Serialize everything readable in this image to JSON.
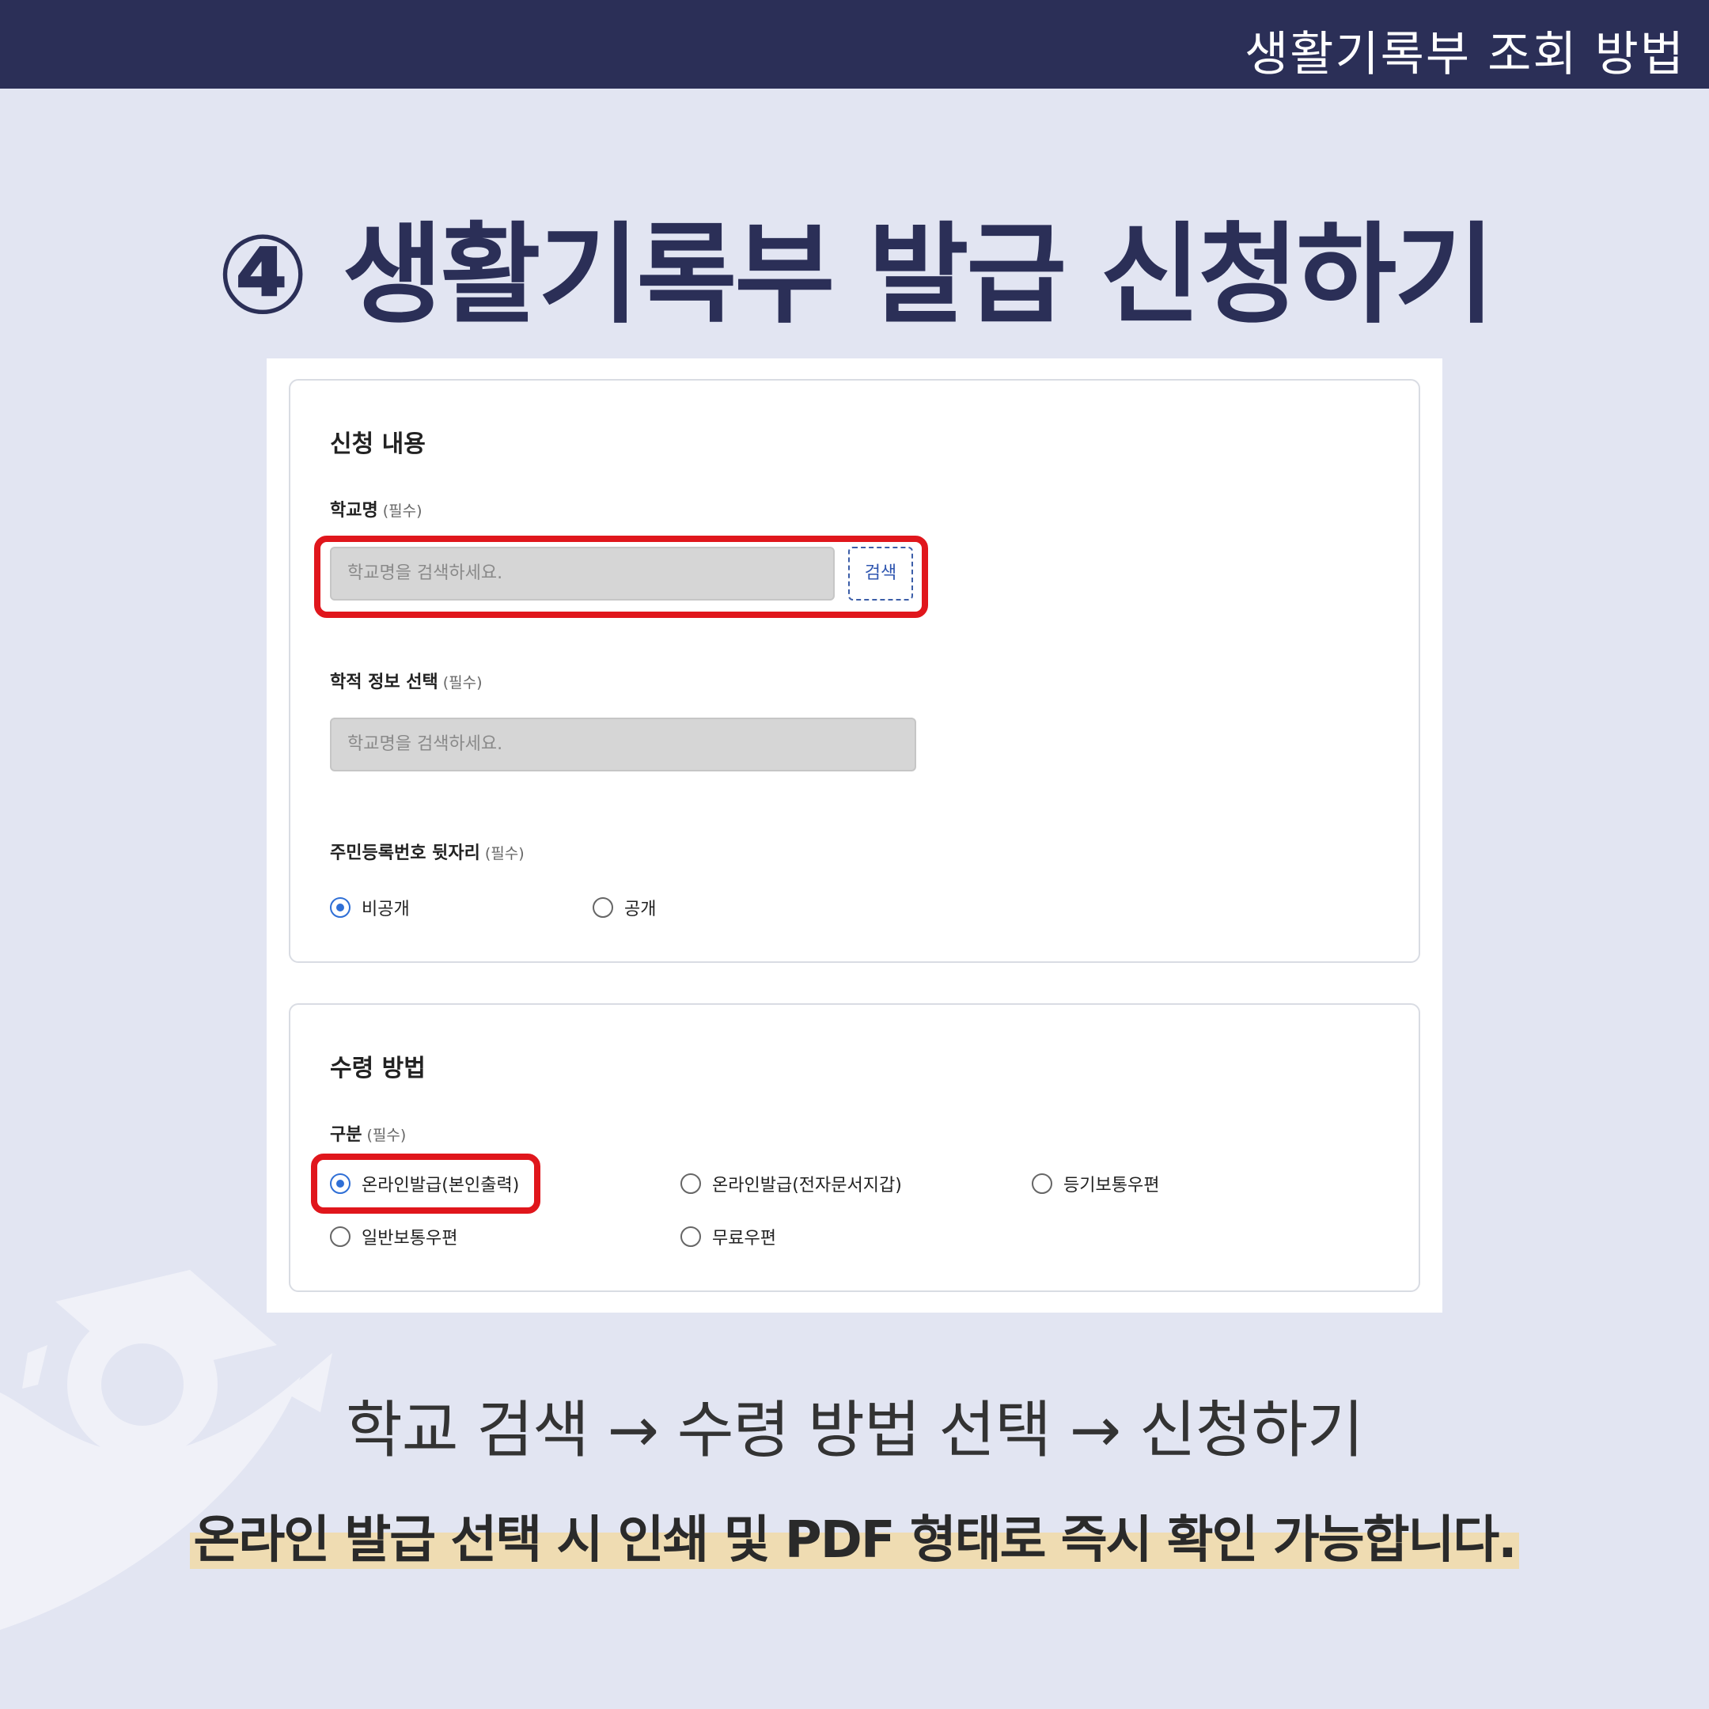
{
  "header": {
    "title": "생활기록부 조회 방법"
  },
  "headline": "④ 생활기록부 발급 신청하기",
  "form": {
    "section1_title": "신청 내용",
    "school": {
      "label": "학교명",
      "required": "(필수)",
      "placeholder": "학교명을 검색하세요.",
      "search_button": "검색"
    },
    "academic": {
      "label": "학적 정보 선택",
      "required": "(필수)",
      "placeholder": "학교명을 검색하세요."
    },
    "resident": {
      "label": "주민등록번호 뒷자리",
      "required": "(필수)",
      "options": [
        {
          "label": "비공개",
          "selected": true
        },
        {
          "label": "공개",
          "selected": false
        }
      ]
    },
    "section2_title": "수령 방법",
    "method": {
      "label": "구분",
      "required": "(필수)",
      "options": [
        {
          "label": "온라인발급(본인출력)",
          "selected": true
        },
        {
          "label": "온라인발급(전자문서지갑)",
          "selected": false
        },
        {
          "label": "등기보통우편",
          "selected": false
        },
        {
          "label": "일반보통우편",
          "selected": false
        },
        {
          "label": "무료우편",
          "selected": false
        }
      ]
    }
  },
  "flow_text": "학교 검색 → 수령 방법 선택 → 신청하기",
  "note_text": "온라인 발급 선택 시 인쇄 및 PDF 형태로 즉시 확인 가능합니다.",
  "colors": {
    "navy": "#2b2f57",
    "background": "#e2e5f2",
    "highlight_red": "#e0161c",
    "radio_blue": "#2f6fd6",
    "note_highlight": "#efdcb2"
  }
}
